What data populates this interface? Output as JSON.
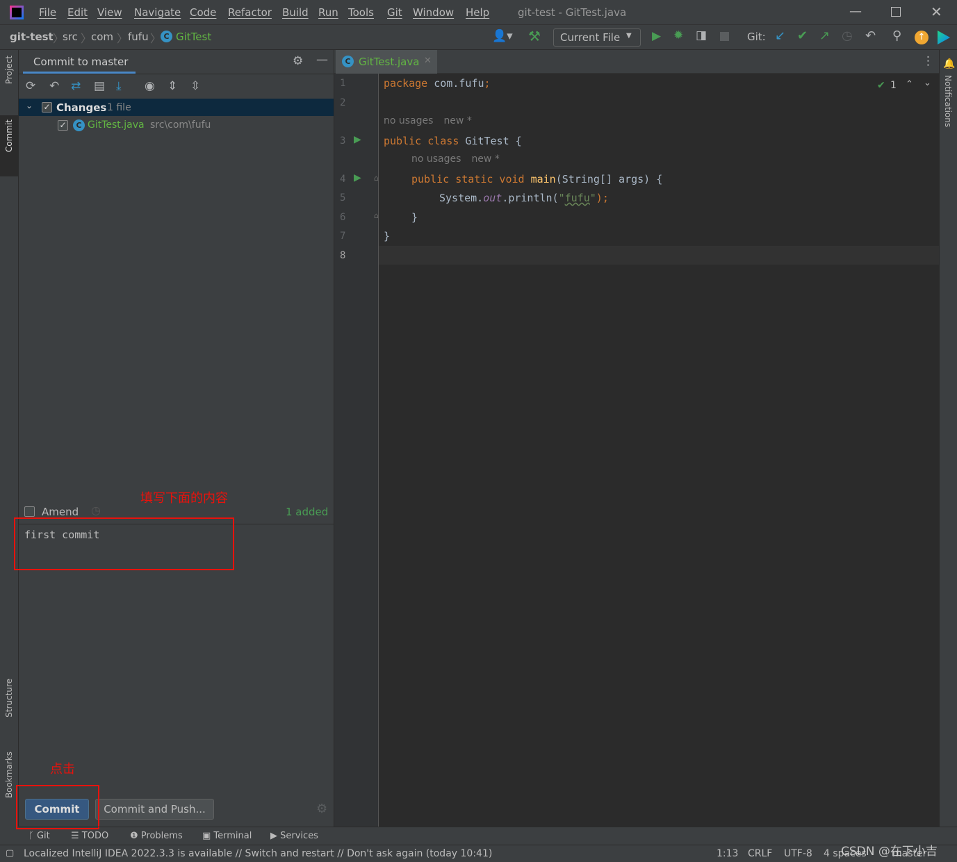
{
  "window": {
    "title": "git-test - GitTest.java",
    "controls": [
      "minimize",
      "maximize",
      "close"
    ]
  },
  "menu": [
    "File",
    "Edit",
    "View",
    "Navigate",
    "Code",
    "Refactor",
    "Build",
    "Run",
    "Tools",
    "Git",
    "Window",
    "Help"
  ],
  "breadcrumb": [
    "git-test",
    "src",
    "com",
    "fufu",
    "GitTest"
  ],
  "toolbar": {
    "run_config": "Current File",
    "git_label": "Git:"
  },
  "left_strip": {
    "project": "Project",
    "commit": "Commit",
    "structure": "Structure",
    "bookmarks": "Bookmarks"
  },
  "commit_panel": {
    "tab": "Commit to master",
    "changes_label": "Changes",
    "changes_count": "1 file",
    "file_name": "GitTest.java",
    "file_path": "src\\com\\fufu",
    "amend": "Amend",
    "added": "1 added",
    "message": "first commit",
    "commit_button": "Commit",
    "commit_push_button": "Commit and Push..."
  },
  "annotations": {
    "fill_hint": "填写下面的内容",
    "click_hint": "点击"
  },
  "editor": {
    "tab": "GitTest.java",
    "inspection_count": "1",
    "usage_hint": "no usages",
    "new_hint": "new *",
    "line_numbers": [
      "1",
      "2",
      "3",
      "4",
      "5",
      "6",
      "7",
      "8"
    ]
  },
  "right_strip": {
    "notifications": "Notifications"
  },
  "tool_windows": [
    "Git",
    "TODO",
    "Problems",
    "Terminal",
    "Services"
  ],
  "status": {
    "message": "Localized IntelliJ IDEA 2022.3.3 is available // Switch and restart // Don't ask again (today 10:41)",
    "position": "1:13",
    "line_sep": "CRLF",
    "encoding": "UTF-8",
    "indent": "4 spaces",
    "branch": "master",
    "watermark": "CSDN @在下小吉"
  }
}
